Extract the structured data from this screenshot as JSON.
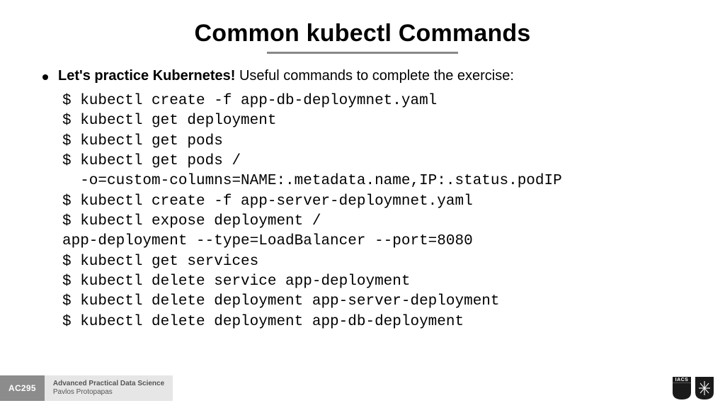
{
  "title": "Common kubectl Commands",
  "lead": {
    "strong": "Let's practice Kubernetes!",
    "rest": " Useful commands to complete the exercise:"
  },
  "code_lines": [
    "$ kubectl create -f app-db-deploymnet.yaml",
    "$ kubectl get deployment",
    "$ kubectl get pods",
    "$ kubectl get pods /",
    "  -o=custom-columns=NAME:.metadata.name,IP:.status.podIP",
    "$ kubectl create -f app-server-deploymnet.yaml",
    "$ kubectl expose deployment /",
    "app-deployment --type=LoadBalancer --port=8080",
    "$ kubectl get services",
    "$ kubectl delete service app-deployment",
    "$ kubectl delete deployment app-server-deployment",
    "$ kubectl delete deployment app-db-deployment"
  ],
  "footer": {
    "course_code": "AC295",
    "course_name": "Advanced Practical Data Science",
    "author": "Pavlos Protopapas",
    "logo1_label": "IACS"
  }
}
